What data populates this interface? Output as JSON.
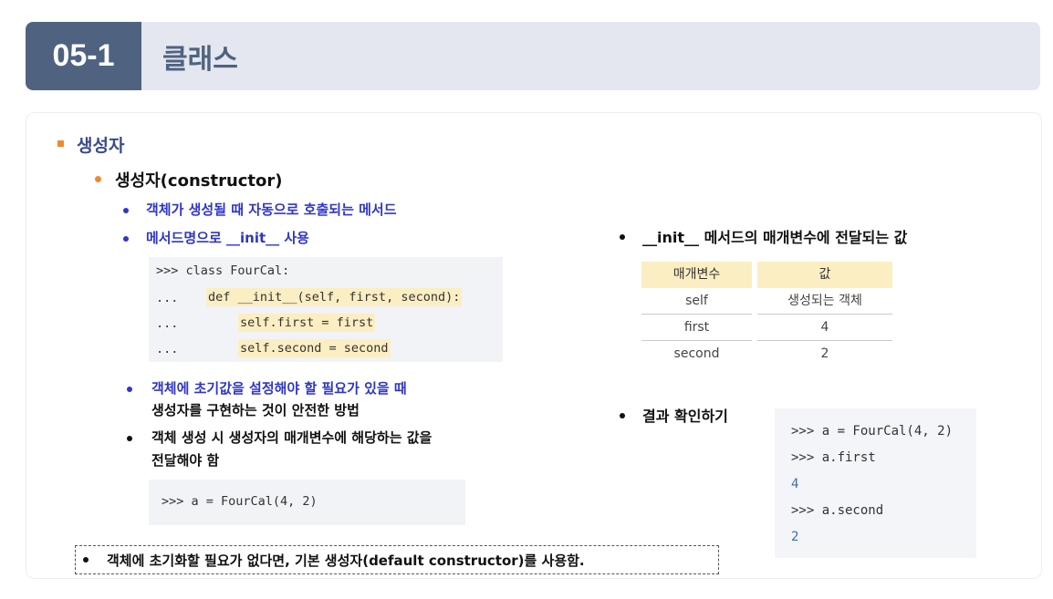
{
  "header": {
    "section_number": "05-1",
    "title": "클래스"
  },
  "left": {
    "heading": "생성자",
    "subheading": "생성자(constructor)",
    "bullets": [
      "객체가 생성될 때 자동으로 호출되는 메서드",
      "메서드명으로 __init__ 사용"
    ],
    "code_lines": [
      ">>> class FourCal:",
      "...",
      "def __init__(self, first, second):",
      "...",
      "self.first = first",
      "...",
      "self.second = second"
    ],
    "note_line1": "객체에 초기값을 설정해야 할 필요가 있을 때",
    "note_line2": "생성자를 구현하는 것이 안전한 방법",
    "note2_line1": "객체 생성 시 생성자의 매개변수에 해당하는 값을",
    "note2_line2": "전달해야 함",
    "code2": ">>> a = FourCal(4, 2)",
    "footer_note": "객체에 초기화할 필요가 없다면, 기본 생성자(default constructor)를 사용함."
  },
  "right": {
    "params_title": "__init__ 메서드의 매개변수에 전달되는 값",
    "table_headers": [
      "매개변수",
      "값"
    ],
    "table_rows": [
      [
        "self",
        "생성되는 객체"
      ],
      [
        "first",
        "4"
      ],
      [
        "second",
        "2"
      ]
    ],
    "result_title": "결과 확인하기",
    "result_lines": [
      ">>> a = FourCal(4, 2)",
      ">>> a.first",
      "4",
      ">>> a.second",
      "2"
    ]
  },
  "colors": {
    "accent_orange": "#f08a2b",
    "title_blue": "#4f6381",
    "text_blue": "#2f36c8",
    "highlight": "#fbeec2"
  }
}
